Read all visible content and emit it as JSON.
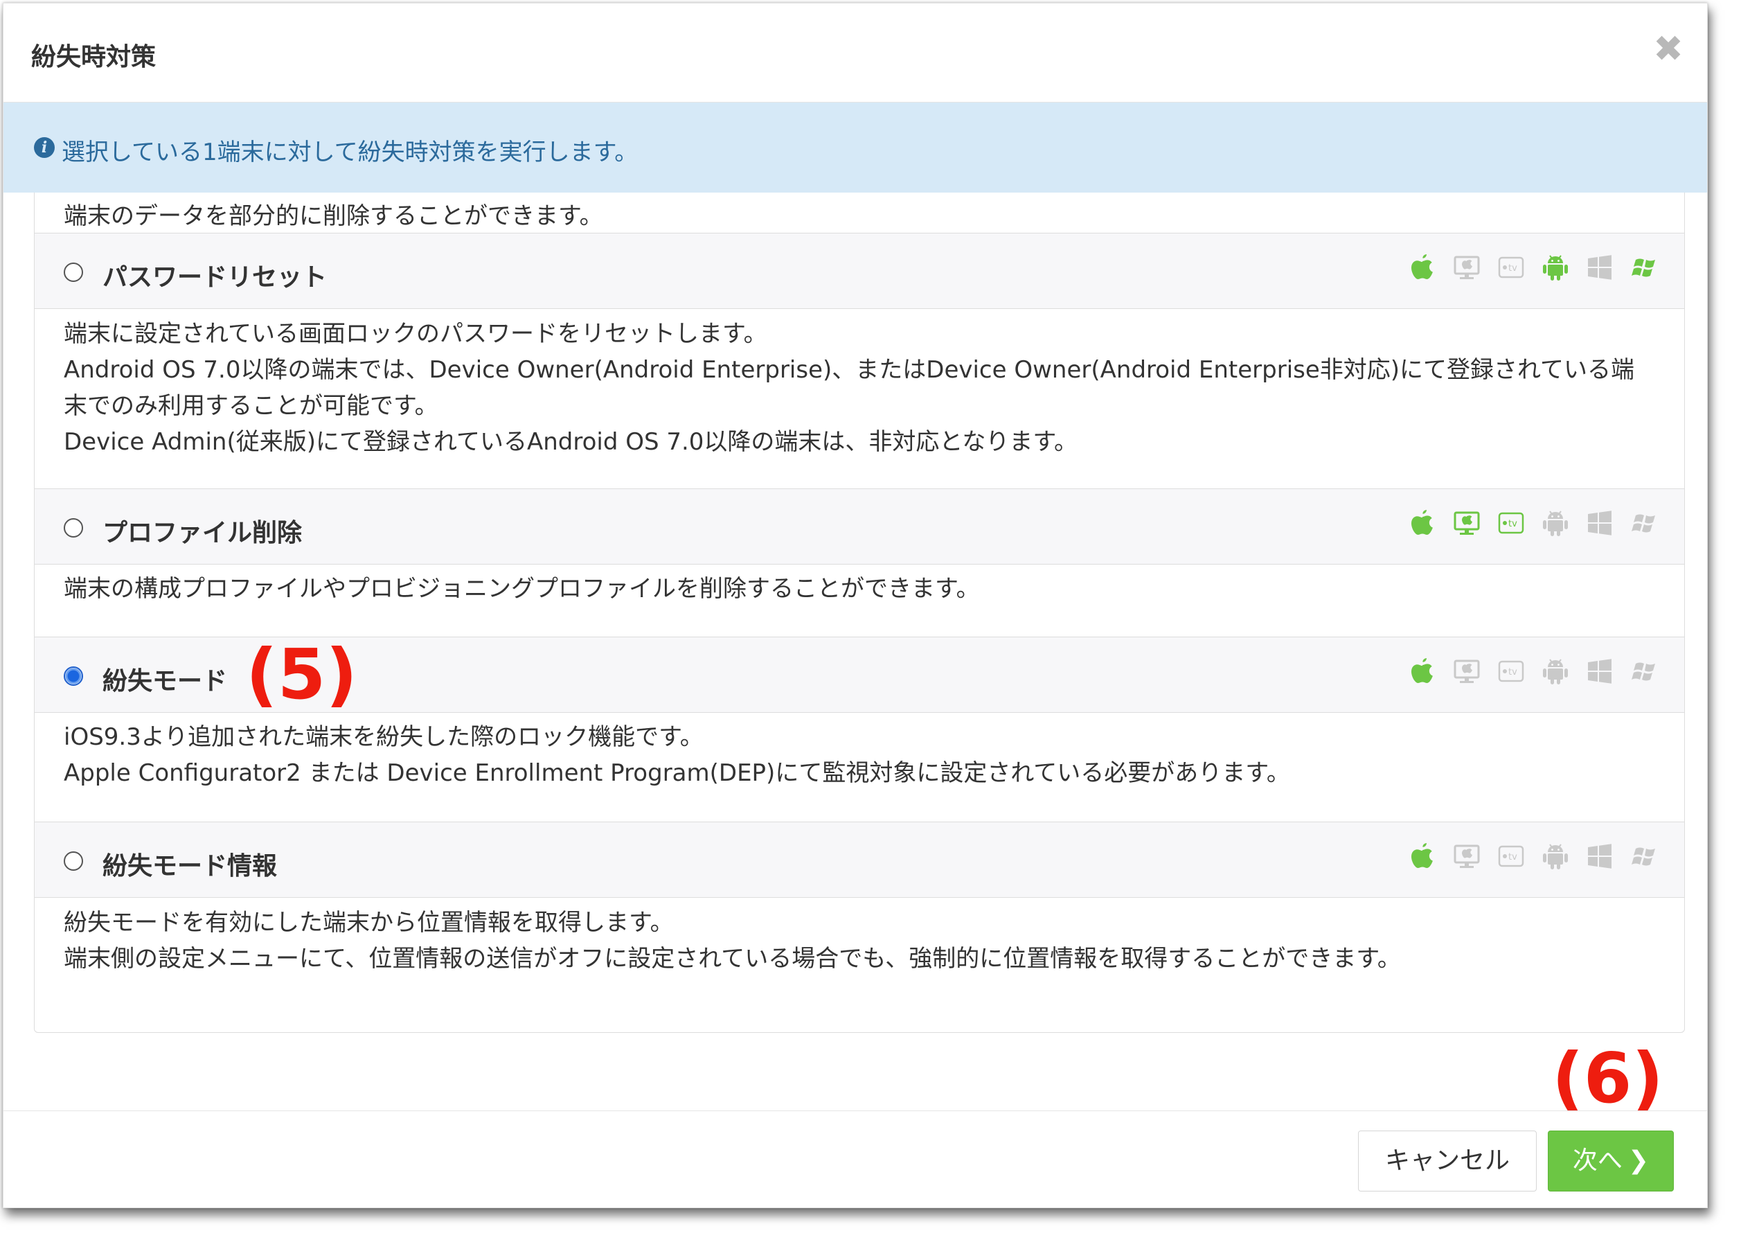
{
  "dialog": {
    "title": "紛失時対策",
    "close_glyph": "✖",
    "info_icon_glyph": "i",
    "info": "選択している1端末に対して紛失時対策を実行します。"
  },
  "top_description": "端末のデータを部分的に削除することができます。",
  "options": [
    {
      "label": "パスワードリセット",
      "selected": false,
      "platform_icons": [
        "apple-icon",
        "macos-icon",
        "apple-tv-icon",
        "android-icon",
        "windows-icon",
        "windows-legacy-icon"
      ],
      "supported": [
        true,
        false,
        false,
        true,
        false,
        true
      ],
      "description": [
        "端末に設定されている画面ロックのパスワードをリセットします。",
        "Android OS 7.0以降の端末では、Device Owner(Android Enterprise)、またはDevice Owner(Android Enterprise非対応)にて登録されている端",
        "末でのみ利用することが可能です。",
        "Device Admin(従来版)にて登録されているAndroid OS 7.0以降の端末は、非対応となります。"
      ]
    },
    {
      "label": "プロファイル削除",
      "selected": false,
      "platform_icons": [
        "apple-icon",
        "macos-icon",
        "apple-tv-icon",
        "android-icon",
        "windows-icon",
        "windows-legacy-icon"
      ],
      "supported": [
        true,
        true,
        true,
        false,
        false,
        false
      ],
      "description": [
        "端末の構成プロファイルやプロビジョニングプロファイルを削除することができます。"
      ]
    },
    {
      "label": "紛失モード",
      "selected": true,
      "platform_icons": [
        "apple-icon",
        "macos-icon",
        "apple-tv-icon",
        "android-icon",
        "windows-icon",
        "windows-legacy-icon"
      ],
      "supported": [
        true,
        false,
        false,
        false,
        false,
        false
      ],
      "description": [
        "iOS9.3より追加された端末を紛失した際のロック機能です。",
        "Apple Configurator2 または Device Enrollment Program(DEP)にて監視対象に設定されている必要があります。"
      ]
    },
    {
      "label": "紛失モード情報",
      "selected": false,
      "platform_icons": [
        "apple-icon",
        "macos-icon",
        "apple-tv-icon",
        "android-icon",
        "windows-icon",
        "windows-legacy-icon"
      ],
      "supported": [
        true,
        false,
        false,
        false,
        false,
        false
      ],
      "description": [
        "紛失モードを有効にした端末から位置情報を取得します。",
        "端末側の設定メニューにて、位置情報の送信がオフに設定されている場合でも、強制的に位置情報を取得することができます。"
      ]
    }
  ],
  "annotations": {
    "step5": "(5)",
    "step6": "(6)"
  },
  "footer": {
    "cancel_label": "キャンセル",
    "next_label": "次へ",
    "next_chevron": "❯"
  },
  "colors": {
    "supported_icon": "#6cc644",
    "unsupported_icon": "#c9c9c9",
    "info_background": "#d6e9f7",
    "info_text": "#2b6a9c",
    "annotation": "#ee1d0f",
    "primary_button": "#6cc644"
  }
}
